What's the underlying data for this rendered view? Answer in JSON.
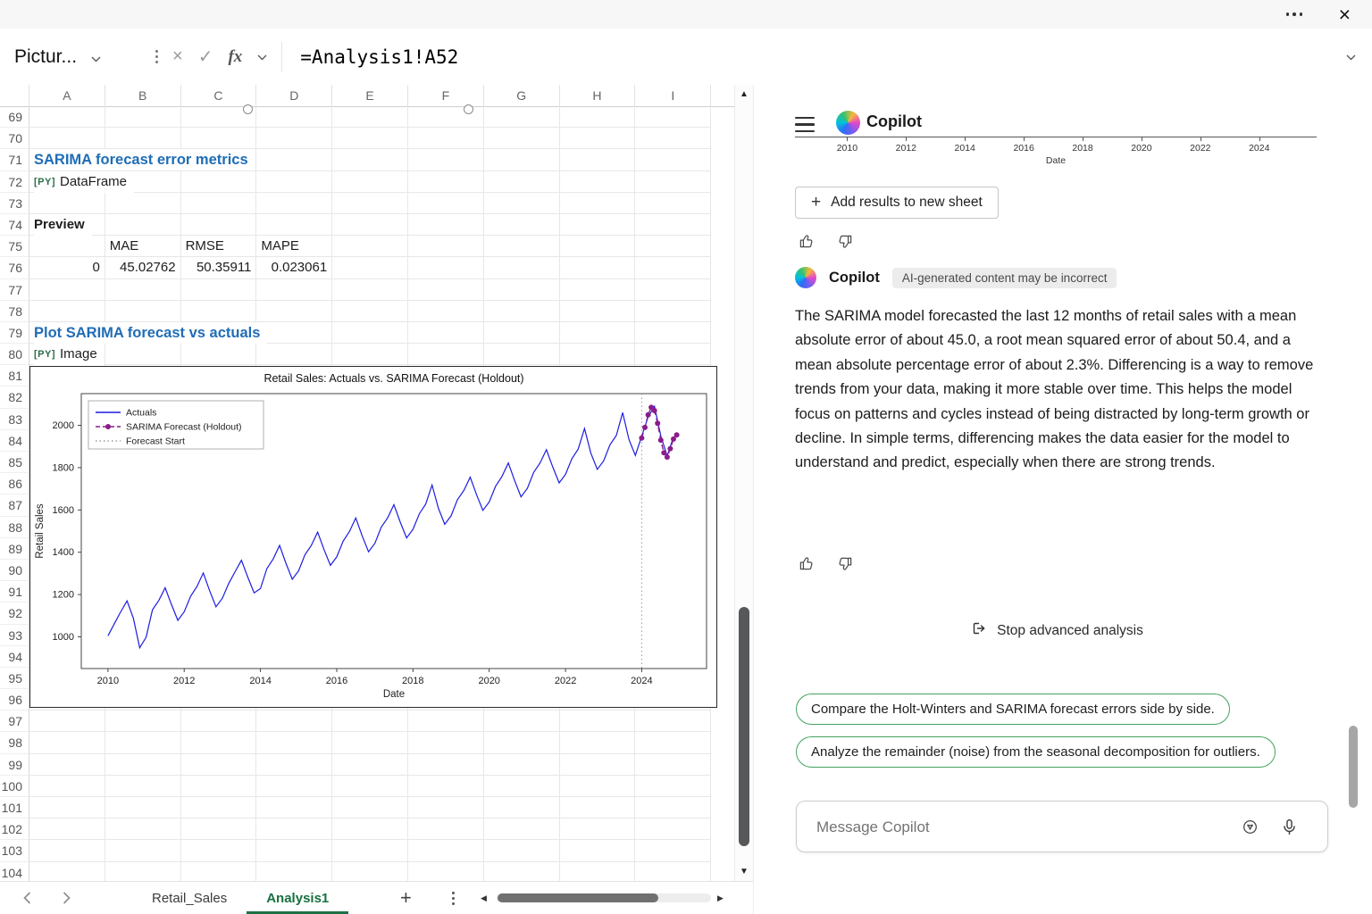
{
  "titlebar": {
    "close_icon_glyph": "×"
  },
  "icons": {
    "cancel": "×",
    "check": "✓",
    "plus": "+",
    "up_arrow": "▲",
    "down_arrow": "▼",
    "left_arrow": "◀",
    "right_arrow": "▶"
  },
  "formula_bar": {
    "name_box": "Pictur...",
    "fx_label": "fx",
    "formula": "=Analysis1!A52"
  },
  "grid": {
    "columns": [
      "A",
      "B",
      "C",
      "D",
      "E",
      "F",
      "G",
      "H",
      "I"
    ],
    "row_start": 69,
    "row_end": 104,
    "py_badge": "[PY]",
    "cells": [
      {
        "row": 71,
        "col": "A",
        "text": "SARIMA forecast error metrics",
        "style": "heading"
      },
      {
        "row": 72,
        "col": "A",
        "text": "DataFrame",
        "style": "py"
      },
      {
        "row": 74,
        "col": "A",
        "text": "Preview",
        "style": "bold"
      },
      {
        "row": 75,
        "col": "B",
        "text": "MAE",
        "style": "txt"
      },
      {
        "row": 75,
        "col": "C",
        "text": "RMSE",
        "style": "txt"
      },
      {
        "row": 75,
        "col": "D",
        "text": "MAPE",
        "style": "txt"
      },
      {
        "row": 76,
        "col": "A",
        "text": "0",
        "style": "num"
      },
      {
        "row": 76,
        "col": "B",
        "text": "45.02762",
        "style": "num"
      },
      {
        "row": 76,
        "col": "C",
        "text": "50.35911",
        "style": "num"
      },
      {
        "row": 76,
        "col": "D",
        "text": "0.023061",
        "style": "num"
      },
      {
        "row": 79,
        "col": "A",
        "text": "Plot SARIMA forecast vs actuals",
        "style": "heading"
      },
      {
        "row": 80,
        "col": "A",
        "text": "Image",
        "style": "py"
      }
    ]
  },
  "chart_data": {
    "type": "line",
    "title": "Retail Sales: Actuals vs. SARIMA Forecast (Holdout)",
    "xlabel": "Date",
    "ylabel": "Retail Sales",
    "xlim": [
      2009.3,
      2025.7
    ],
    "ylim": [
      850,
      2150
    ],
    "xticks": [
      2010,
      2012,
      2014,
      2016,
      2018,
      2020,
      2022,
      2024
    ],
    "yticks": [
      1000,
      1200,
      1400,
      1600,
      1800,
      2000
    ],
    "legend": [
      "Actuals",
      "SARIMA Forecast (Holdout)",
      "Forecast Start"
    ],
    "legend_position": "upper left",
    "grid": false,
    "forecast_start_x": 2024.0,
    "series": [
      {
        "name": "Actuals",
        "color": "#1c1ce0",
        "style": "solid",
        "x_start": 2010.0,
        "x_step": 0.16667,
        "values": [
          1005,
          1062,
          1118,
          1170,
          1088,
          948,
          998,
          1128,
          1172,
          1232,
          1152,
          1078,
          1118,
          1192,
          1238,
          1302,
          1218,
          1142,
          1182,
          1252,
          1308,
          1362,
          1282,
          1208,
          1228,
          1322,
          1368,
          1432,
          1348,
          1272,
          1312,
          1388,
          1432,
          1495,
          1412,
          1338,
          1378,
          1452,
          1498,
          1562,
          1478,
          1402,
          1442,
          1518,
          1562,
          1625,
          1542,
          1468,
          1508,
          1582,
          1628,
          1718,
          1608,
          1532,
          1572,
          1648,
          1692,
          1755,
          1672,
          1598,
          1638,
          1712,
          1758,
          1822,
          1738,
          1662,
          1702,
          1778,
          1822,
          1885,
          1802,
          1728,
          1768,
          1842,
          1888,
          1985,
          1868,
          1792,
          1832,
          1908,
          1952,
          2060,
          1932,
          1858,
          1950,
          2040,
          2090,
          1950,
          1855,
          1945
        ]
      },
      {
        "name": "SARIMA Forecast (Holdout)",
        "color": "#8b1c8b",
        "style": "dashed-markers",
        "x_start": 2024.0,
        "x_step": 0.08333,
        "values": [
          1940,
          1990,
          2050,
          2085,
          2070,
          2010,
          1930,
          1870,
          1850,
          1890,
          1935,
          1955
        ]
      }
    ]
  },
  "copilot": {
    "title": "Copilot",
    "chart_fragment": {
      "ticks": [
        "2010",
        "2012",
        "2014",
        "2016",
        "2018",
        "2020",
        "2022",
        "2024"
      ],
      "label": "Date"
    },
    "add_results_button": "Add results to new sheet",
    "response_author": "Copilot",
    "ai_badge": "AI-generated content may be incorrect",
    "response_text": "The SARIMA model forecasted the last 12 months of retail sales with a mean absolute error of about 45.0, a root mean squared error of about 50.4, and a mean absolute percentage error of about 2.3%. Differencing is a way to remove trends from your data, making it more stable over time. This helps the model focus on patterns and cycles instead of being distracted by long-term growth or decline. In simple terms, differencing makes the data easier for the model to understand and predict, especially when there are strong trends.",
    "stop_button": "Stop advanced analysis",
    "suggestions": [
      "Compare the Holt-Winters and SARIMA forecast errors side by side.",
      "Analyze the remainder (noise) from the seasonal decomposition for outliers."
    ],
    "input_placeholder": "Message Copilot"
  },
  "sheet_tabs": {
    "tabs": [
      "Retail_Sales",
      "Analysis1"
    ],
    "active_index": 1
  },
  "colors": {
    "heading_blue": "#1f6db6",
    "excel_green": "#1e7145",
    "actuals_blue": "#1c1ce0",
    "forecast_purple": "#8b1c8b",
    "pill_green": "#43a25f"
  }
}
